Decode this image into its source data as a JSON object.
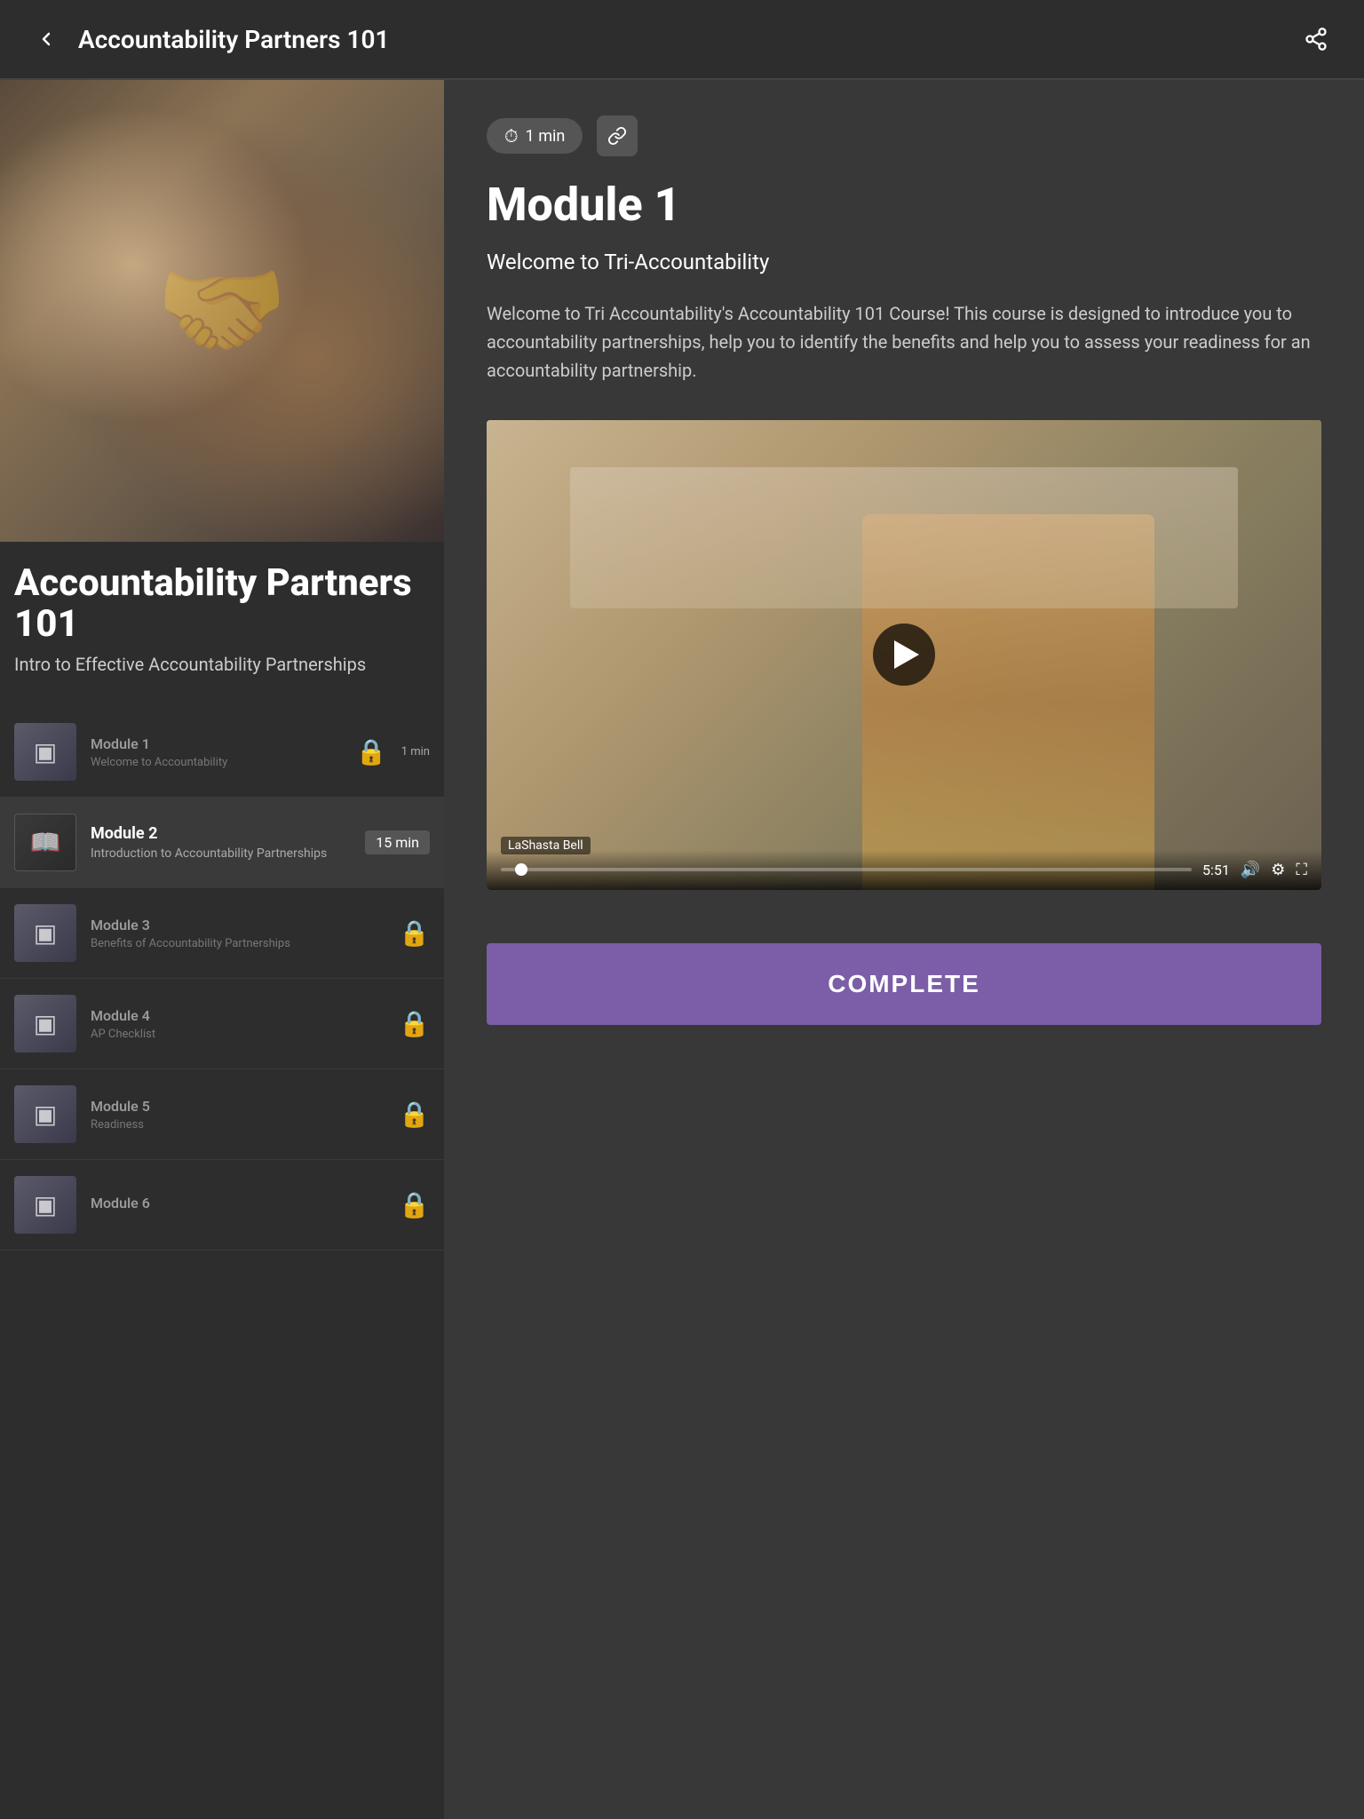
{
  "header": {
    "title": "Accountability Partners 101",
    "back_label": "←",
    "share_label": "share"
  },
  "course": {
    "main_title": "Accountability Partners 101",
    "subtitle": "Intro to Effective Accountability Partnerships"
  },
  "modules": [
    {
      "id": 1,
      "name": "Module 1",
      "description": "Welcome to Accountability",
      "duration": "1 min",
      "locked": true,
      "active": false,
      "thumb_icon": "▣"
    },
    {
      "id": 2,
      "name": "Module 2",
      "description": "Introduction to Accountability Partnerships",
      "duration": "15 min",
      "locked": false,
      "active": true,
      "thumb_icon": "📖"
    },
    {
      "id": 3,
      "name": "Module 3",
      "description": "Benefits of Accountability Partnerships",
      "duration": "",
      "locked": true,
      "active": false,
      "thumb_icon": "▣"
    },
    {
      "id": 4,
      "name": "Module 4",
      "description": "AP Checklist",
      "duration": "",
      "locked": true,
      "active": false,
      "thumb_icon": "▣"
    },
    {
      "id": 5,
      "name": "Module 5",
      "description": "Readiness",
      "duration": "",
      "locked": true,
      "active": false,
      "thumb_icon": "▣"
    },
    {
      "id": 6,
      "name": "Module 6",
      "description": "",
      "duration": "",
      "locked": true,
      "active": false,
      "thumb_icon": "▣"
    }
  ],
  "right_panel": {
    "time_badge": "1 min",
    "module_heading": "Module 1",
    "module_subheading": "Welcome to Tri-Accountability",
    "module_description": "Welcome to Tri Accountability's Accountability 101 Course! This course is designed to introduce you to accountability partnerships, help you to identify the benefits and help you to assess your readiness for an accountability partnership.",
    "video_time": "5:51",
    "video_presenter": "LaShasta Bell",
    "complete_button": "COMPLETE"
  }
}
